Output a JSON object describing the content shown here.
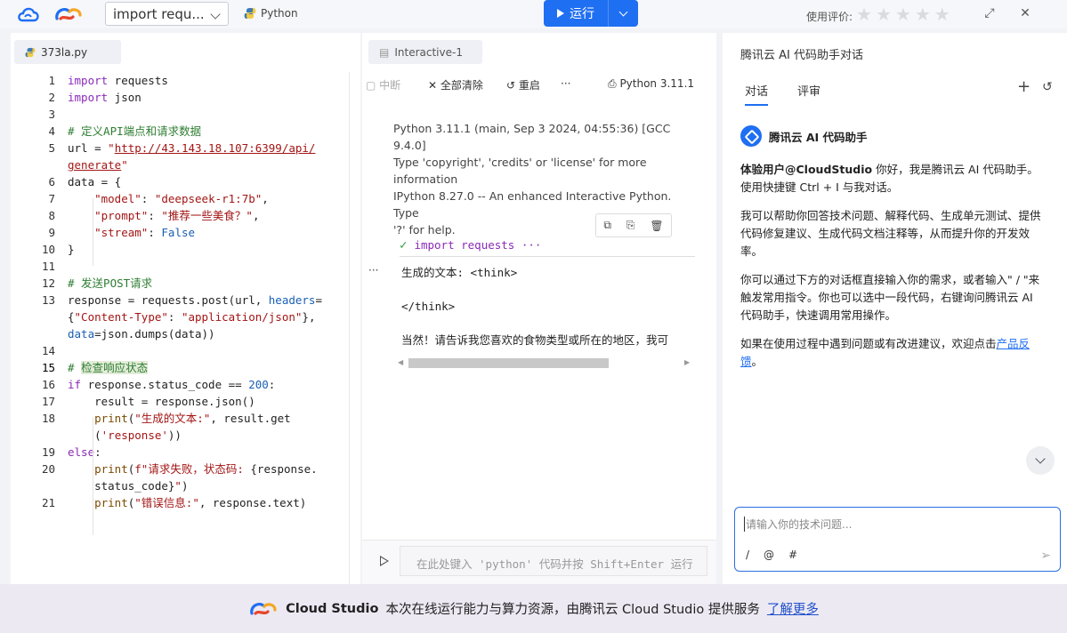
{
  "topbar": {
    "file_select": "import requ...",
    "language": "Python",
    "run_label": "运行",
    "rating_label": "使用评价:"
  },
  "editor": {
    "tab": "373la.py",
    "lines": [
      {
        "n": "1",
        "html": "<span class=\"kw\">import</span> requests"
      },
      {
        "n": "2",
        "html": "<span class=\"kw\">import</span> json"
      },
      {
        "n": "3",
        "html": ""
      },
      {
        "n": "4",
        "html": "<span class=\"cm\"># 定义API端点和请求数据</span>"
      },
      {
        "n": "5",
        "html": "url = <span class=\"st\">\"<span class=\"u\">http://43.143.18.107:6399/api/</span></span>"
      },
      {
        "n": "",
        "html": "<span class=\"st u\">generate</span><span class=\"st\">\"</span>"
      },
      {
        "n": "6",
        "html": "data = {"
      },
      {
        "n": "7",
        "html": "    <span class=\"st\">\"model\"</span>: <span class=\"st\">\"deepseek-r1:7b\"</span>,"
      },
      {
        "n": "8",
        "html": "    <span class=\"st\">\"prompt\"</span>: <span class=\"st\">\"推荐一些美食？\"</span>,"
      },
      {
        "n": "9",
        "html": "    <span class=\"st\">\"stream\"</span>: <span class=\"nm\">False</span>"
      },
      {
        "n": "10",
        "html": "}"
      },
      {
        "n": "11",
        "html": ""
      },
      {
        "n": "12",
        "html": "<span class=\"cm\"># 发送POST请求</span>"
      },
      {
        "n": "13",
        "html": "response = requests.post(url, <span class=\"nm\">headers</span>="
      },
      {
        "n": "",
        "html": "{<span class=\"st\">\"Content-Type\"</span>: <span class=\"st\">\"application/json\"</span>},"
      },
      {
        "n": "",
        "html": "<span class=\"nm\">data</span>=json.dumps(data))"
      },
      {
        "n": "14",
        "html": ""
      },
      {
        "n": "15",
        "html": "<span class=\"cm\"># <span class=\"hl\">检查响应状态</span></span>"
      },
      {
        "n": "16",
        "html": "<span class=\"kw\">if</span> response.status_code == <span class=\"nm\">200</span>:"
      },
      {
        "n": "17",
        "html": "    result = response.json()"
      },
      {
        "n": "18",
        "html": "    <span class=\"fn\">print</span>(<span class=\"st\">\"生成的文本:\"</span>, result.get"
      },
      {
        "n": "",
        "html": "    (<span class=\"st\">'response'</span>))"
      },
      {
        "n": "19",
        "html": "<span class=\"kw\">else</span>:"
      },
      {
        "n": "20",
        "html": "    <span class=\"fn\">print</span>(<span class=\"st\">f\"请求失败，状态码: </span>{response."
      },
      {
        "n": "",
        "html": "    status_code}<span class=\"st\">\"</span>)"
      },
      {
        "n": "21",
        "html": "    <span class=\"fn\">print</span>(<span class=\"st\">\"错误信息:\"</span>, response.text)"
      }
    ]
  },
  "interactive": {
    "tab": "Interactive-1",
    "interrupt": "中断",
    "clear_all": "全部清除",
    "restart": "重启",
    "more": "···",
    "kernel": "Python 3.11.1",
    "banner_lines": [
      "Python 3.11.1 (main, Sep 3 2024, 04:55:36) [GCC 9.4.0]",
      "Type 'copyright', 'credits' or 'license' for more",
      "information",
      "IPython 8.27.0 -- An enhanced Interactive Python. Type",
      "'?' for help."
    ],
    "cell_input": "import requests ···",
    "cell_output": "生成的文本: <think>\n\n</think>\n\n当然！请告诉我您喜欢的食物类型或所在的地区，我可",
    "input_placeholder": "在此处键入 'python' 代码并按 Shift+Enter 运行"
  },
  "chat": {
    "title": "腾讯云 AI 代码助手对话",
    "tab_chat": "对话",
    "tab_review": "评审",
    "bot_name": "腾讯云 AI 代码助手",
    "greeting_user": "体验用户@CloudStudio",
    "greeting_rest": " 你好，我是腾讯云 AI 代码助手。使用快捷键 Ctrl + I 与我对话。",
    "p2": "我可以帮助你回答技术问题、解释代码、生成单元测试、提供代码修复建议、生成代码文档注释等，从而提升你的开发效率。",
    "p3": "你可以通过下方的对话框直接输入你的需求，或者输入\" / \"来触发常用指令。你也可以选中一段代码，右键询问腾讯云 AI 代码助手，快速调用常用操作。",
    "p4_text": "如果在使用过程中遇到问题或有改进建议，欢迎点击",
    "p4_link": "产品反馈",
    "p4_end": "。",
    "input_placeholder": "请输入你的技术问题...",
    "sym_slash": "/",
    "sym_at": "@",
    "sym_hash": "#"
  },
  "banner": {
    "brand": "Cloud Studio",
    "text": "本次在线运行能力与算力资源，由腾讯云 Cloud Studio 提供服务",
    "link": "了解更多"
  }
}
